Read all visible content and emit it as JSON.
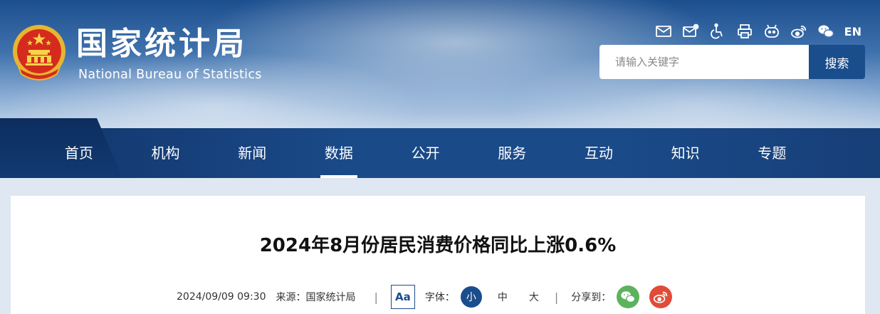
{
  "site": {
    "name_cn": "国家统计局",
    "name_en": "National Bureau of Statistics"
  },
  "toolbar": {
    "icons": [
      "mail-icon",
      "mail-settings-icon",
      "accessibility-icon",
      "printer-icon",
      "robot-icon",
      "weibo-icon",
      "wechat-icon"
    ],
    "language_label": "EN"
  },
  "search": {
    "placeholder": "请输入关键字",
    "button_label": "搜索"
  },
  "nav": {
    "items": [
      {
        "label": "首页"
      },
      {
        "label": "机构"
      },
      {
        "label": "新闻"
      },
      {
        "label": "数据"
      },
      {
        "label": "公开"
      },
      {
        "label": "服务"
      },
      {
        "label": "互动"
      },
      {
        "label": "知识"
      },
      {
        "label": "专题"
      }
    ],
    "active_index": 3
  },
  "article": {
    "title": "2024年8月份居民消费价格同比上涨0.6%",
    "date": "2024/09/09 09:30",
    "source": "来源：国家统计局",
    "separator": "|",
    "font_toggle_label": "Aa",
    "font_label": "字体：",
    "font_sizes": [
      "小",
      "中",
      "大"
    ],
    "active_font_size": "小",
    "share_label": "分享到："
  },
  "colors": {
    "brand_blue": "#1a4d8b",
    "nav_blue": "#1a4a88",
    "wechat_green": "#5db35d",
    "weibo_red": "#e04c38"
  }
}
